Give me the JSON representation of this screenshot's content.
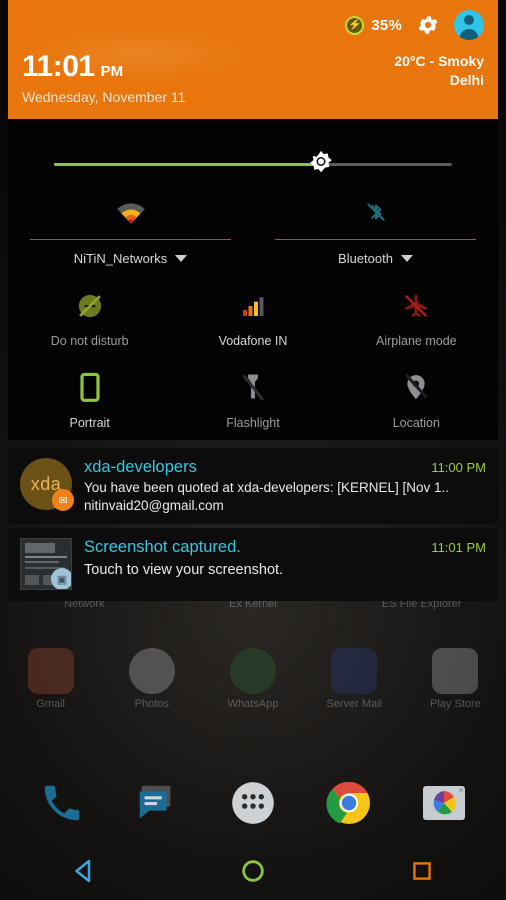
{
  "statusbar": {
    "battery_percent": "35%",
    "battery_icon": "battery-charging-icon",
    "settings_icon": "gear-icon",
    "avatar_icon": "user-avatar-icon"
  },
  "header": {
    "time": "11:01",
    "ampm": "PM",
    "date": "Wednesday, November 11",
    "weather_condition": "20°C - Smoky",
    "weather_location": "Delhi",
    "background_color": "#e8760c"
  },
  "quick_settings": {
    "brightness": {
      "label": "brightness-slider",
      "value_percent": 67,
      "fill_color": "#8cc63e",
      "track_color": "#5d5d5d",
      "thumb_icon": "brightness-sun-icon"
    },
    "dual_tiles": [
      {
        "label": "NiTiN_Networks",
        "icon": "wifi-icon",
        "state": "on",
        "has_caret": true
      },
      {
        "label": "Bluetooth",
        "icon": "bluetooth-off-icon",
        "state": "off",
        "has_caret": true
      }
    ],
    "tiles": [
      {
        "label": "Do not disturb",
        "icon": "do-not-disturb-icon",
        "state": "off"
      },
      {
        "label": "Vodafone IN",
        "icon": "cell-signal-icon",
        "state": "on"
      },
      {
        "label": "Airplane mode",
        "icon": "airplane-off-icon",
        "state": "off"
      },
      {
        "label": "Portrait",
        "icon": "screen-rotation-portrait-icon",
        "state": "on"
      },
      {
        "label": "Flashlight",
        "icon": "flashlight-off-icon",
        "state": "off"
      },
      {
        "label": "Location",
        "icon": "location-off-icon",
        "state": "off"
      }
    ]
  },
  "notifications": [
    {
      "app": "xda-developers",
      "time": "11:00 PM",
      "line1": "You have been quoted at xda-developers: [KERNEL] [Nov 1..",
      "line2": "nitinvaid20@gmail.com",
      "avatar_text": "xda",
      "badge_icon": "gmail-badge-icon"
    },
    {
      "app": "Screenshot captured.",
      "time": "11:01 PM",
      "line1": "Touch to view your screenshot.",
      "line2": "",
      "avatar_text": "",
      "badge_icon": "gallery-badge-icon"
    }
  ],
  "home_screen": {
    "app_row_labels": [
      "Gmail",
      "Photos",
      "WhatsApp",
      "Server Mail",
      "Play Store"
    ],
    "widget_row_labels": [
      "Network",
      "Ex Kernel",
      "ES File Explorer"
    ],
    "dock": [
      {
        "label": "Phone",
        "icon": "phone-icon"
      },
      {
        "label": "Messages",
        "icon": "messages-icon"
      },
      {
        "label": "Apps",
        "icon": "app-drawer-icon"
      },
      {
        "label": "Chrome",
        "icon": "chrome-icon"
      },
      {
        "label": "Photos",
        "icon": "photos-icon"
      }
    ]
  },
  "navbar": {
    "back": "back-nav-button",
    "home": "home-nav-button",
    "recents": "recents-nav-button",
    "back_color": "#3aa6e0",
    "home_color": "#8cc63e",
    "recents_color": "#e8760c"
  }
}
